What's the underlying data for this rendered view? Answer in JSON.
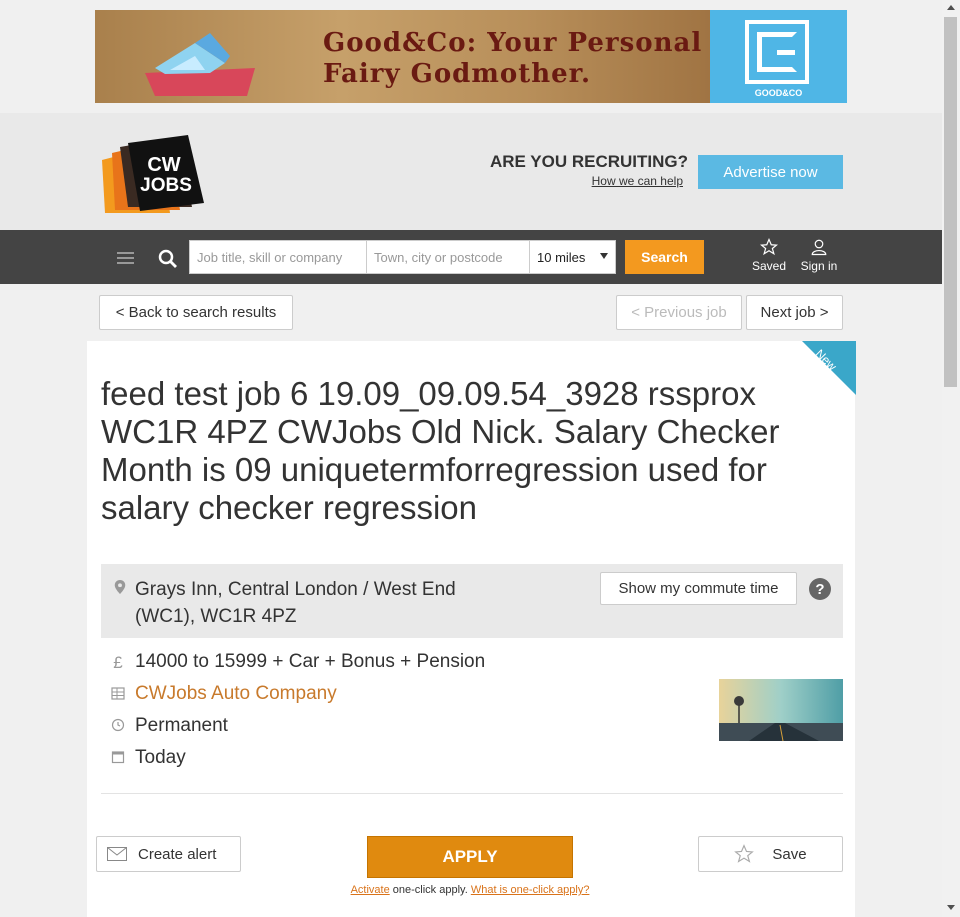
{
  "ad": {
    "headline_line1": "Good&Co: Your Personal",
    "headline_line2": "Fairy Godmother.",
    "brand": "GOOD&CO"
  },
  "header": {
    "recruiting": "ARE YOU RECRUITING?",
    "how_link": "How we can help",
    "advertise": "Advertise now",
    "logo_line1": "CW",
    "logo_line2": "JOBS"
  },
  "search": {
    "keyword_placeholder": "Job title, skill or company",
    "location_placeholder": "Town, city or postcode",
    "radius": "10 miles",
    "button": "Search",
    "saved": "Saved",
    "sign_in": "Sign in"
  },
  "job_nav": {
    "back": "< Back to search results",
    "previous": "< Previous job",
    "next": "Next job >"
  },
  "job": {
    "badge": "New",
    "title": "feed test job 6 19.09_09.09.54_3928 rssprox WC1R 4PZ CWJobs Old Nick. Salary Checker Month is 09 uniquetermforregression used for salary checker regression",
    "location_line1": "Grays Inn, Central London / West End",
    "location_line2": "(WC1), WC1R 4PZ",
    "commute": "Show my commute time",
    "salary": "14000 to 15999 + Car + Bonus + Pension",
    "company": "CWJobs Auto Company",
    "type": "Permanent",
    "posted": "Today"
  },
  "actions": {
    "create_alert": "Create alert",
    "apply": "APPLY",
    "save": "Save",
    "activate": "Activate",
    "one_click_text": "one-click apply.",
    "what_is": "What is one-click apply?"
  }
}
